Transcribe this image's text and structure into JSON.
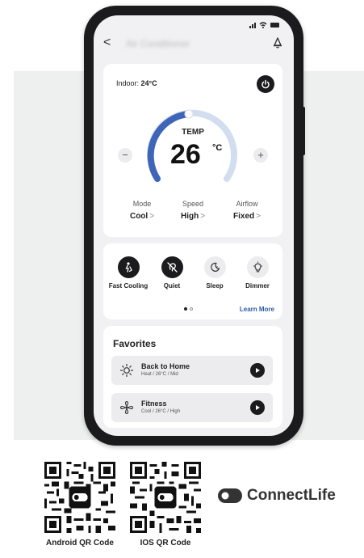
{
  "nav": {
    "title": "Air Conditioner"
  },
  "indoor": {
    "label": "Indoor:",
    "value": "24°C"
  },
  "temperature": {
    "label": "TEMP",
    "value": "26",
    "unit": "°C",
    "minus": "−",
    "plus": "+"
  },
  "controls": [
    {
      "label": "Mode",
      "value": "Cool"
    },
    {
      "label": "Speed",
      "value": "High"
    },
    {
      "label": "Airflow",
      "value": "Fixed"
    }
  ],
  "chevron": ">",
  "modes": [
    {
      "label": "Fast Cooling",
      "active": true,
      "icon": "fast-cooling-icon"
    },
    {
      "label": "Quiet",
      "active": true,
      "icon": "quiet-icon"
    },
    {
      "label": "Sleep",
      "active": false,
      "icon": "sleep-icon"
    },
    {
      "label": "Dimmer",
      "active": false,
      "icon": "dimmer-icon"
    }
  ],
  "learn_more": "Learn More",
  "favorites": {
    "title": "Favorites",
    "items": [
      {
        "name": "Back to Home",
        "details": "Heat / 26°C / Mid",
        "icon": "sun-icon"
      },
      {
        "name": "Fitness",
        "details": "Cool / 26°C / High",
        "icon": "fan-icon"
      }
    ]
  },
  "qr": {
    "android_label": "Android QR Code",
    "ios_label": "IOS QR Code"
  },
  "brand": {
    "name": "ConnectLife"
  },
  "colors": {
    "accent": "#3e65b8",
    "arc_track": "#d3ddf0",
    "dark": "#1b1b1d",
    "link": "#2b5aa6"
  }
}
